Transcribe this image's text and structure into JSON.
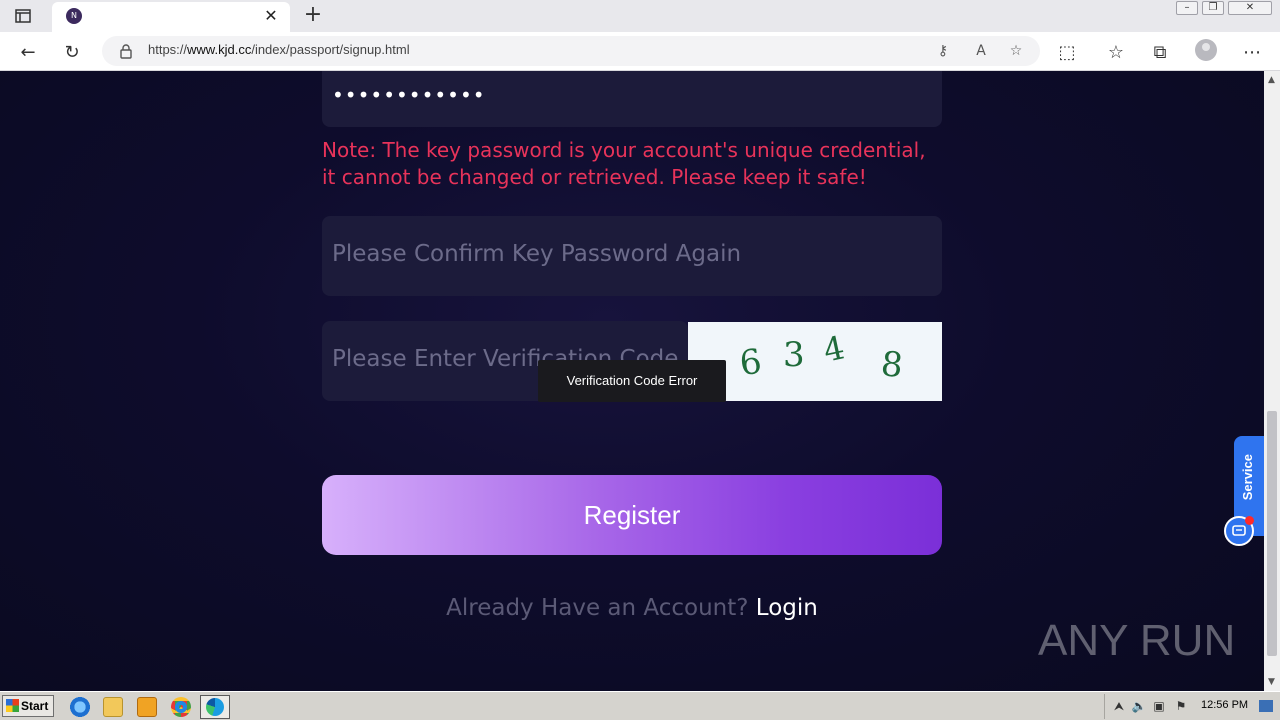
{
  "browser": {
    "tab_favicon": "N",
    "url_prefix": "https://",
    "url_host": "www.kjd.cc",
    "url_path": "/index/passport/signup.html"
  },
  "form": {
    "password_mask": "••••••••••••",
    "note": "Note: The key password is your account's unique credential, it cannot be changed or retrieved. Please keep it safe!",
    "confirm_placeholder": "Please Confirm Key Password Again",
    "verification_placeholder": "Please Enter Verification Code",
    "captcha_digits": [
      "6",
      "3",
      "4",
      "8"
    ],
    "tooltip": "Verification Code Error",
    "register_label": "Register",
    "already_text": "Already Have an Account?",
    "login_label": "Login"
  },
  "widgets": {
    "service_label": "Service",
    "watermark": "ANY RUN"
  },
  "taskbar": {
    "start_label": "Start",
    "clock": "12:56 PM"
  },
  "colors": {
    "note_red": "#e8335a",
    "register_gradient_start": "#d7b0fb",
    "register_gradient_end": "#7b2fd8",
    "service_blue": "#2f74ef"
  }
}
